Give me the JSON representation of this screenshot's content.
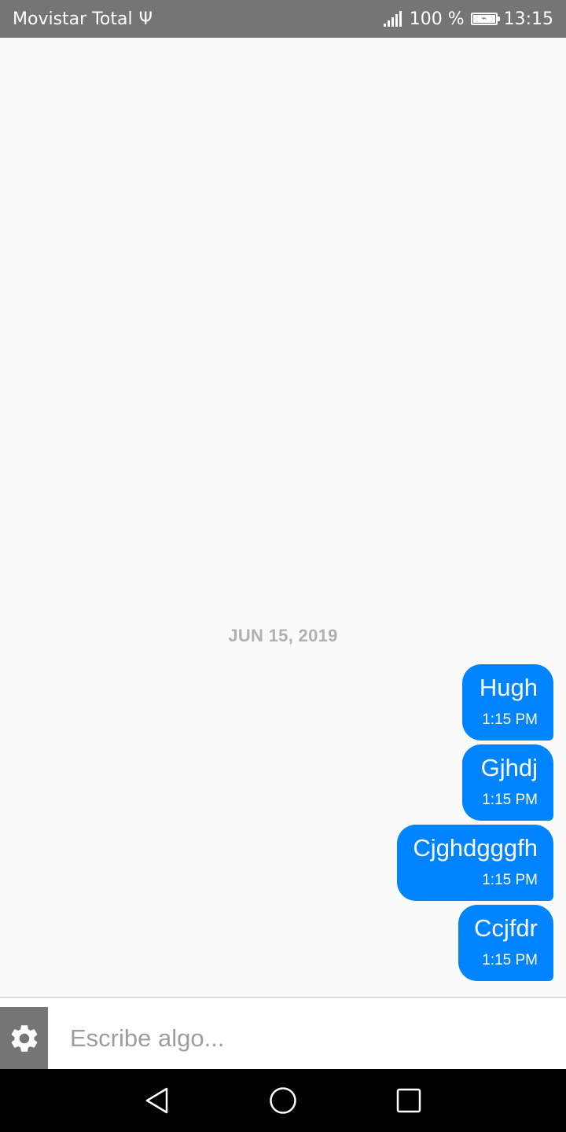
{
  "status_bar": {
    "carrier": "Movistar Total",
    "battery_percent": "100 %",
    "time": "13:15",
    "icons": [
      "usb-icon",
      "signal-icon",
      "battery-charging-icon"
    ]
  },
  "conversation": {
    "date_separator": "JUN 15, 2019",
    "messages": [
      {
        "text": "Hugh",
        "time": "1:15 PM"
      },
      {
        "text": "Gjhdj",
        "time": "1:15 PM"
      },
      {
        "text": "Cjghdgggfh",
        "time": "1:15 PM"
      },
      {
        "text": "Ccjfdr",
        "time": "1:15 PM"
      }
    ]
  },
  "composer": {
    "placeholder": "Escribe algo...",
    "value": "",
    "settings_icon": "gear-icon"
  },
  "navigation": {
    "icons": [
      "back-icon",
      "home-icon",
      "recents-icon"
    ]
  },
  "colors": {
    "accent": "#0084ff",
    "status_bar": "#757575",
    "date_separator": "#b0b0b0"
  }
}
